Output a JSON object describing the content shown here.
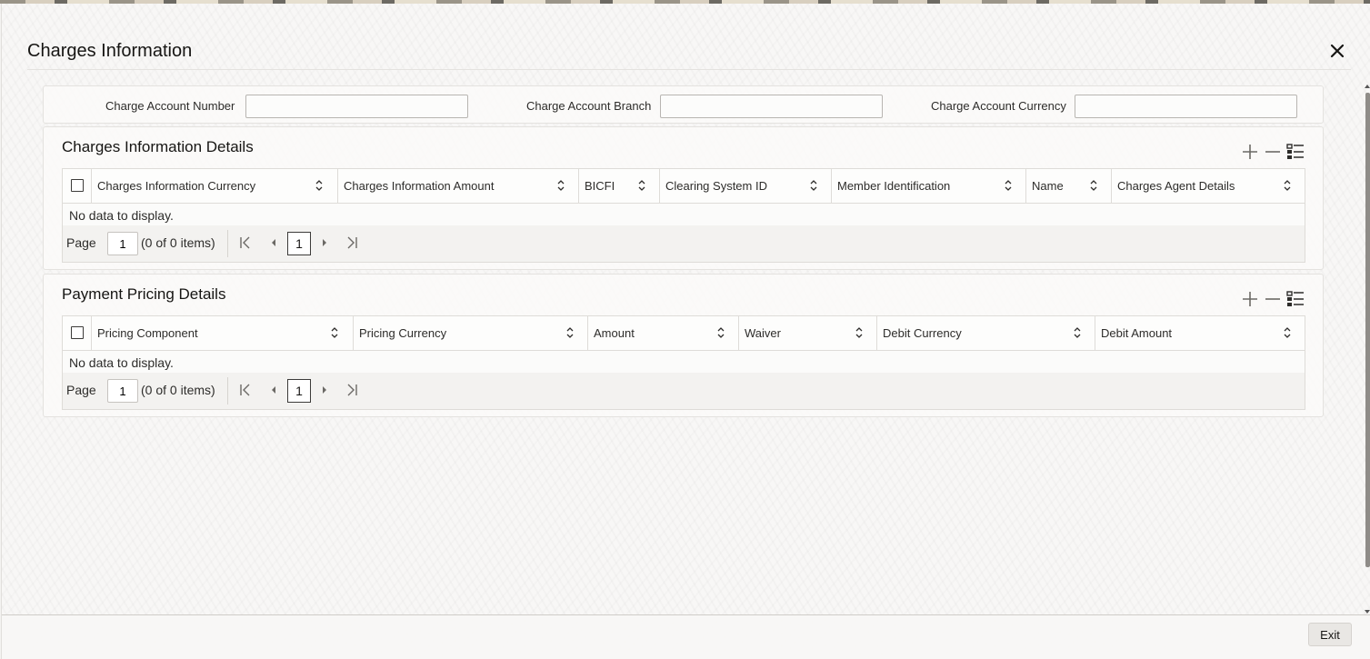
{
  "dialog": {
    "title": "Charges Information"
  },
  "charge_account": {
    "number_label": "Charge Account Number",
    "number_value": "",
    "branch_label": "Charge Account Branch",
    "branch_value": "",
    "currency_label": "Charge Account Currency",
    "currency_value": ""
  },
  "charges_grid": {
    "title": "Charges Information Details",
    "columns": [
      "Charges Information Currency",
      "Charges Information Amount",
      "BICFI",
      "Clearing System ID",
      "Member Identification",
      "Name",
      "Charges Agent Details"
    ],
    "empty_text": "No data to display.",
    "pager": {
      "page_label": "Page",
      "page_input": "1",
      "count_text": "(0 of 0 items)",
      "current_page": "1"
    }
  },
  "pricing_grid": {
    "title": "Payment Pricing Details",
    "columns": [
      "Pricing Component",
      "Pricing Currency",
      "Amount",
      "Waiver",
      "Debit Currency",
      "Debit Amount"
    ],
    "empty_text": "No data to display.",
    "pager": {
      "page_label": "Page",
      "page_input": "1",
      "count_text": "(0 of 0 items)",
      "current_page": "1"
    }
  },
  "footer": {
    "exit_label": "Exit"
  },
  "icons": {
    "close": "close-icon",
    "add": "add-icon",
    "remove": "remove-icon",
    "column_settings": "list-settings-icon",
    "sort": "sort-icon",
    "first_page": "first-page-icon",
    "prev_page": "prev-page-icon",
    "next_page": "next-page-icon",
    "last_page": "last-page-icon"
  }
}
